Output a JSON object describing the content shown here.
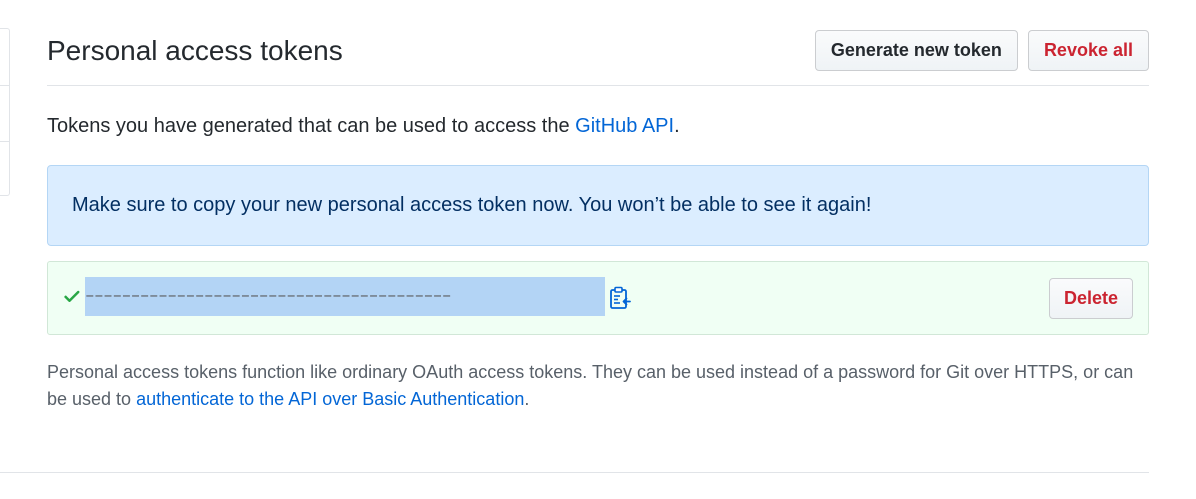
{
  "header": {
    "title": "Personal access tokens",
    "generate_label": "Generate new token",
    "revoke_label": "Revoke all"
  },
  "intro": {
    "text": "Tokens you have generated that can be used to access the ",
    "link_text": "GitHub API",
    "suffix": "."
  },
  "flash": {
    "message": "Make sure to copy your new personal access token now. You won’t be able to see it again!"
  },
  "token": {
    "value": "––––––––––––––––––––––––––––––––––––––––",
    "status_icon": "check-icon",
    "copy_icon": "clippy-icon",
    "delete_label": "Delete"
  },
  "note": {
    "text": "Personal access tokens function like ordinary OAuth access tokens. They can be used instead of a password for Git over HTTPS, or can be used to ",
    "link_text": "authenticate to the API over Basic Authentication",
    "suffix": "."
  },
  "colors": {
    "link": "#0366d6",
    "danger": "#cb2431",
    "flash_bg": "#dbedff",
    "success_bg": "#f0fff4",
    "success_icon": "#28a745",
    "selection": "#b3d4f5"
  }
}
